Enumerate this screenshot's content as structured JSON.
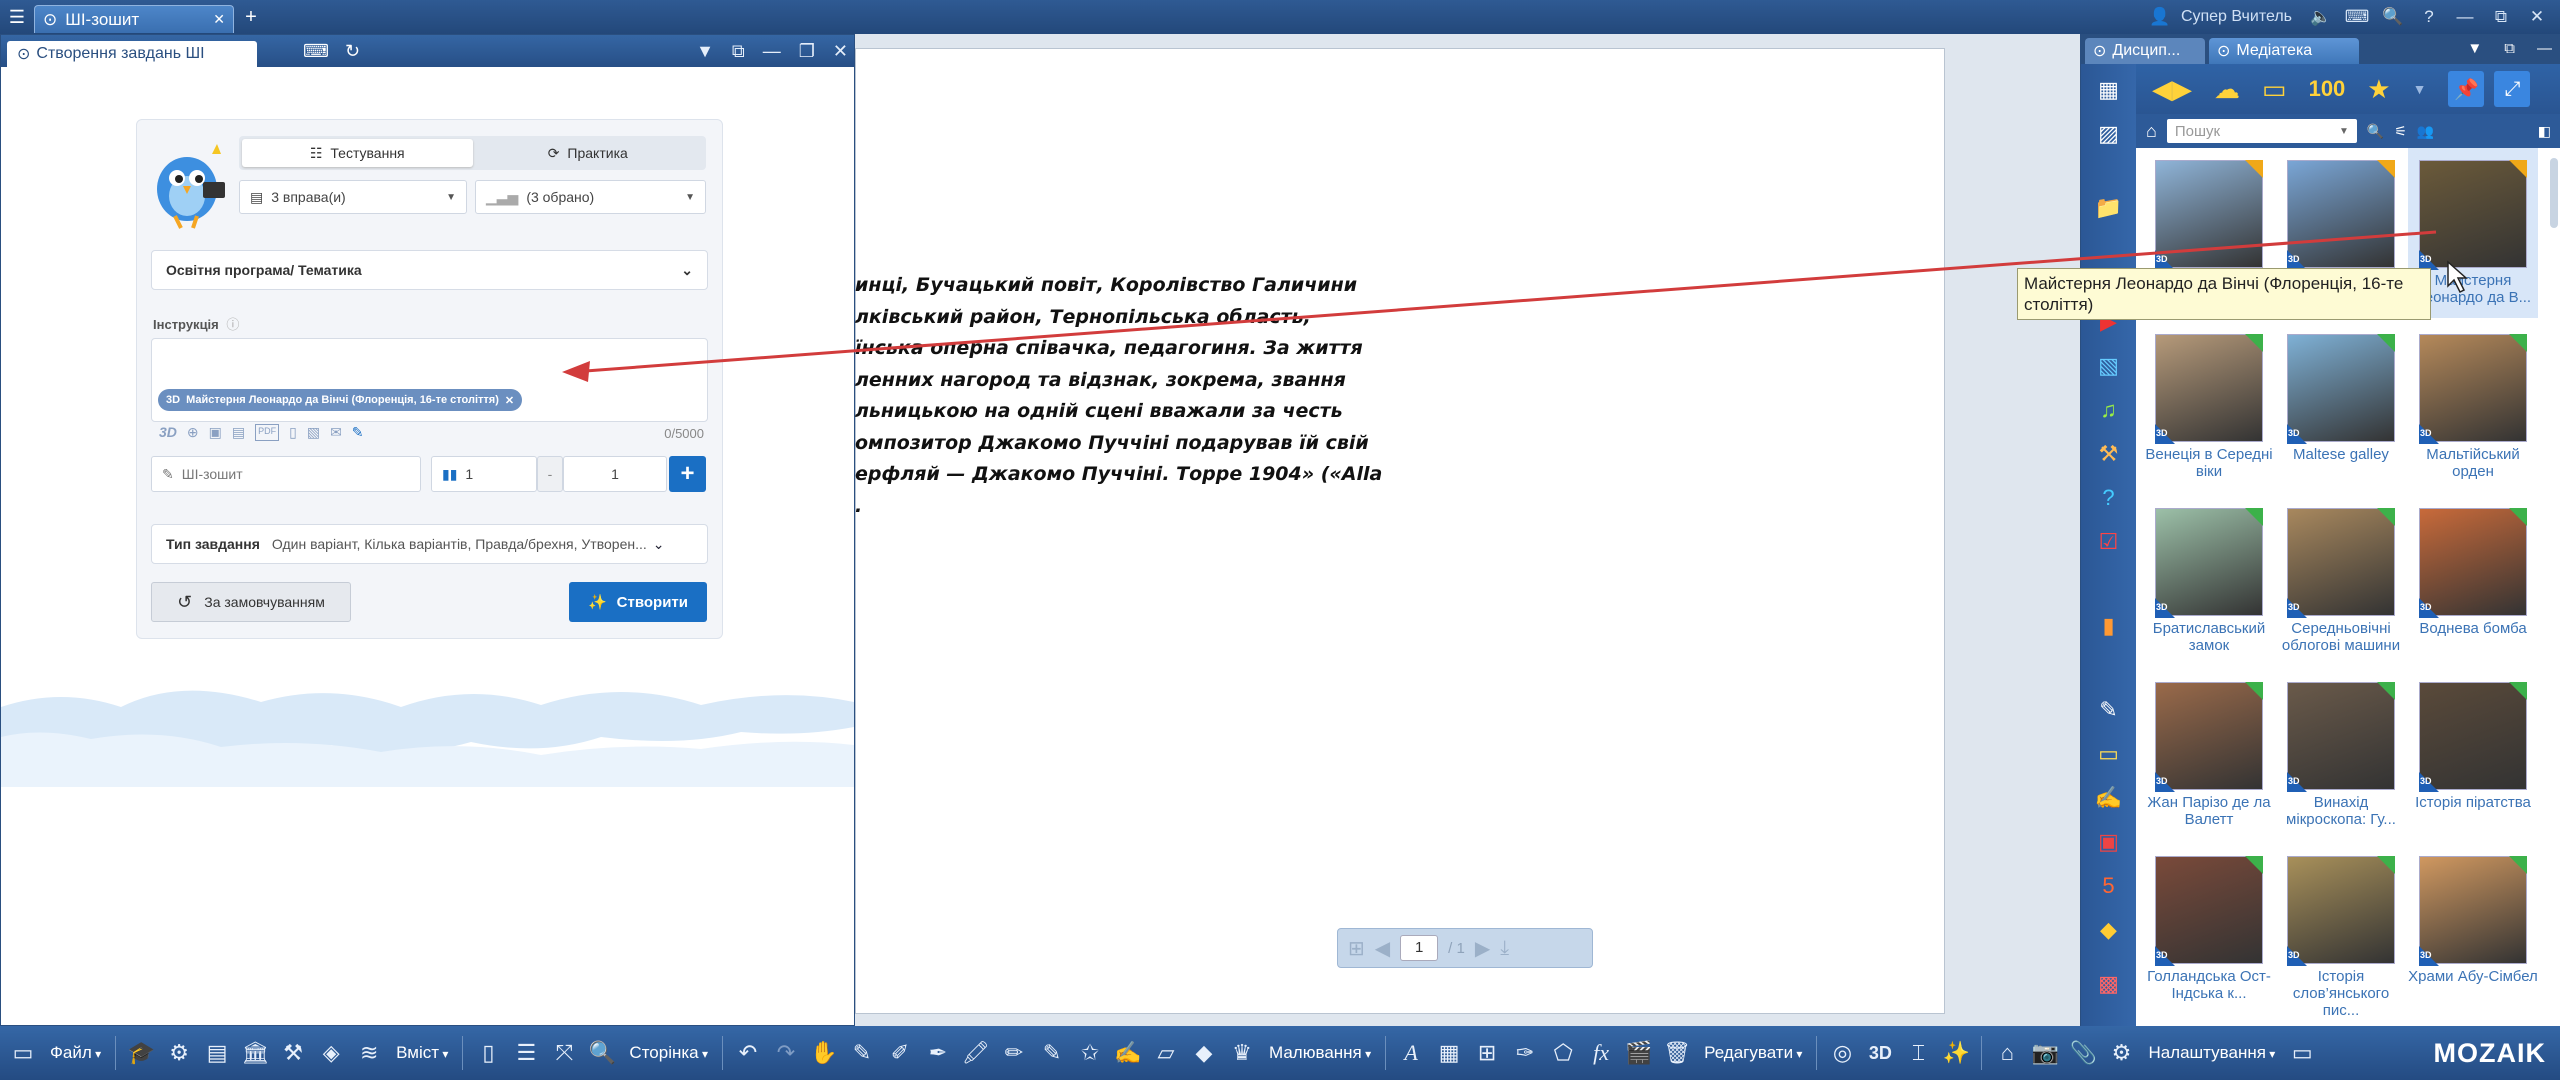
{
  "topbar": {
    "tab_title": "ШІ-зошит",
    "user_name": "Супер Вчитель"
  },
  "left_panel": {
    "title": "Створення завдань ШІ",
    "tabs": [
      {
        "label": "Тестування"
      },
      {
        "label": "Практика"
      }
    ],
    "exercises_select": "3 вправа(и)",
    "chosen_select": "(3 обрано)",
    "program_select": "Освітня програма/ Тематика",
    "instruction_label": "Інструкція",
    "chip_badge": "3D",
    "chip_label": "Майстерня Леонардо да Вінчі (Флоренція, 16-те століття)",
    "counter": "0/5000",
    "notebook_placeholder": "ШІ-зошит",
    "range_from": "1",
    "range_sep": "-",
    "range_to": "1",
    "task_type_label": "Тип завдання",
    "task_type_value": "Один варіант, Кілька варіантів, Правда/брехня, Утворен...",
    "default_button": "За замовчуванням",
    "create_button": "Створити"
  },
  "page": {
    "lines": [
      "инці, Бучацький повіт, Королівство Галичини",
      "лківський район, Тернопільська область,",
      "їнська оперна співачка, педагогиня. За життя",
      "ленних нагород та відзнак, зокрема, звання",
      "льницькою на одній сцені вважали за честь",
      "омпозитор Джакомо Пуччіні подарував їй свій",
      "ерфляй — Джакомо Пуччіні. Торре 1904» («Alla",
      "."
    ],
    "pager_current": "1",
    "pager_total": "/ 1"
  },
  "right_panel": {
    "tabs": [
      {
        "label": "Дисцип..."
      },
      {
        "label": "Медіатека"
      }
    ],
    "toolbar_counter": "100",
    "search_placeholder": "Пошук",
    "tooltip": "Майстерня Леонардо да Вінчі (Флоренція, 16-те століття)",
    "tiles": [
      {
        "caption": "",
        "badge": "3D",
        "corner": "gold",
        "bg": "#8fb4d8"
      },
      {
        "caption": "",
        "badge": "3D",
        "corner": "gold",
        "bg": "#7aa6d6"
      },
      {
        "caption": "Майстерня Леонардо да В...",
        "badge": "3D",
        "corner": "gold",
        "bg": "#6b5a3a"
      },
      {
        "caption": "Венеція в Середні віки",
        "badge": "3D",
        "corner": "green",
        "bg": "#b69a7a"
      },
      {
        "caption": "Maltese galley",
        "badge": "3D",
        "corner": "green",
        "bg": "#7fb1d6"
      },
      {
        "caption": "Мальтійський орден",
        "badge": "3D",
        "corner": "green",
        "bg": "#b5895a"
      },
      {
        "caption": "Братиславський замок",
        "badge": "3D",
        "corner": "green",
        "bg": "#9cc0a8"
      },
      {
        "caption": "Середньовічні облогові машини",
        "badge": "3D",
        "corner": "green",
        "bg": "#a8885e"
      },
      {
        "caption": "Воднева бомба",
        "badge": "3D",
        "corner": "green",
        "bg": "#c86a3a"
      },
      {
        "caption": "Жан Парізо де ла Валетт",
        "badge": "3D",
        "corner": "green",
        "bg": "#9a6a4a"
      },
      {
        "caption": "Винахід мікроскопа: Гу...",
        "badge": "3D",
        "corner": "green",
        "bg": "#6a5a4a"
      },
      {
        "caption": "Історія піратства",
        "badge": "3D",
        "corner": "green",
        "bg": "#5a4a3a"
      },
      {
        "caption": "Голландська Ост-Індська к...",
        "badge": "3D",
        "corner": "green",
        "bg": "#7a4a3a"
      },
      {
        "caption": "Історія слов’янського пис...",
        "badge": "3D",
        "corner": "green",
        "bg": "#a8905a"
      },
      {
        "caption": "Храми Абу-Сімбел",
        "badge": "3D",
        "corner": "green",
        "bg": "#d09860"
      }
    ]
  },
  "bottombar": {
    "file": "Файл",
    "content": "Вміст",
    "page": "Сторінка",
    "drawing": "Малювання",
    "edit": "Редагувати",
    "settings": "Налаштування",
    "logo": "MOZAIK"
  },
  "colors": {
    "accent": "#1a6fc4",
    "chrome": "#2a4f80",
    "arrow": "#d23c3c"
  }
}
